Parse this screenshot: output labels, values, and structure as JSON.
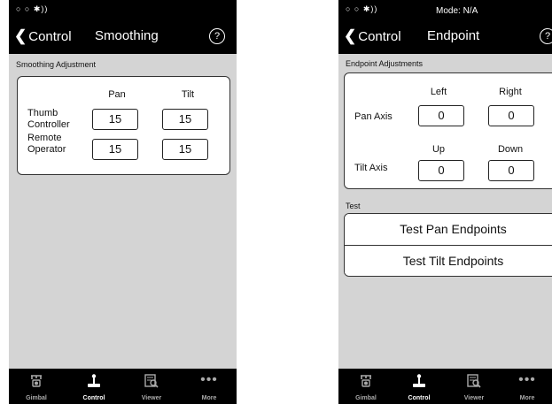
{
  "screen1": {
    "status": "○ ○  ✱))",
    "back_label": "Control",
    "title": "Smoothing",
    "help": "?",
    "section": "Smoothing Adjustment",
    "col_pan": "Pan",
    "col_tilt": "Tilt",
    "rows": [
      {
        "label": "Thumb Controller",
        "pan": "15",
        "tilt": "15"
      },
      {
        "label": "Remote Operator",
        "pan": "15",
        "tilt": "15"
      }
    ]
  },
  "screen2": {
    "status": "○ ○  ✱))",
    "mode": "Mode: N/A",
    "back_label": "Control",
    "title": "Endpoint",
    "help": "?",
    "section": "Endpoint Adjustments",
    "pan_axis": {
      "label": "Pan Axis",
      "left_label": "Left",
      "right_label": "Right",
      "left": "0",
      "right": "0"
    },
    "tilt_axis": {
      "label": "Tilt Axis",
      "up_label": "Up",
      "down_label": "Down",
      "up": "0",
      "down": "0"
    },
    "test_section": "Test",
    "test_pan": "Test Pan Endpoints",
    "test_tilt": "Test Tilt Endpoints"
  },
  "tabs": [
    {
      "label": "Gimbal",
      "icon": "gimbal-icon"
    },
    {
      "label": "Control",
      "icon": "joystick-icon"
    },
    {
      "label": "Viewer",
      "icon": "viewer-icon"
    },
    {
      "label": "More",
      "icon": "more-icon"
    }
  ],
  "active_tab": "Control"
}
